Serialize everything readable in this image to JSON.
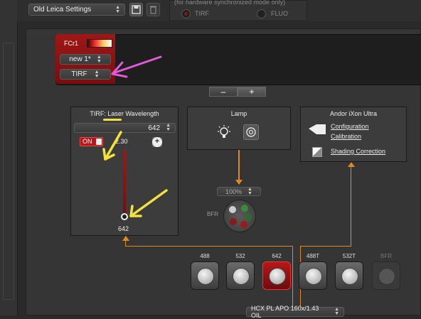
{
  "settings": {
    "selected": "Old Leica Settings"
  },
  "sync": {
    "note": "(for hardware synchronized mode only)",
    "options": [
      "TIRF",
      "FLUO"
    ]
  },
  "fcr": {
    "name": "FCr1",
    "preset": "new 1*",
    "mode": "TIRF"
  },
  "controls": {
    "minus": "–",
    "plus": "+"
  },
  "tirf_panel": {
    "title": "TIRF: Laser Wavelength",
    "wavelength": "642",
    "on_label": "ON",
    "power_value": "2.30",
    "power_unit": "%",
    "slider_label": "642",
    "add_symbol": "+"
  },
  "lamp": {
    "title": "Lamp"
  },
  "camera": {
    "title": "Andor iXon Ultra",
    "links": [
      "Configuration",
      "Calibration",
      "Shading Correction"
    ]
  },
  "turret": {
    "intensity": "100%",
    "label": "BFR"
  },
  "filters": [
    {
      "label": "488",
      "state": "normal"
    },
    {
      "label": "532",
      "state": "normal"
    },
    {
      "label": "642",
      "state": "active"
    },
    {
      "label": "488T",
      "state": "normal"
    },
    {
      "label": "532T",
      "state": "normal"
    },
    {
      "label": "BFR",
      "state": "dim"
    }
  ],
  "objective": {
    "selected": "HCX PL APO  160x/1.43 OIL"
  },
  "colors": {
    "accent_orange": "#e08a1e",
    "active_red": "#b51818",
    "annotation_pink": "#e05ad8",
    "annotation_yellow": "#f2e23a"
  }
}
